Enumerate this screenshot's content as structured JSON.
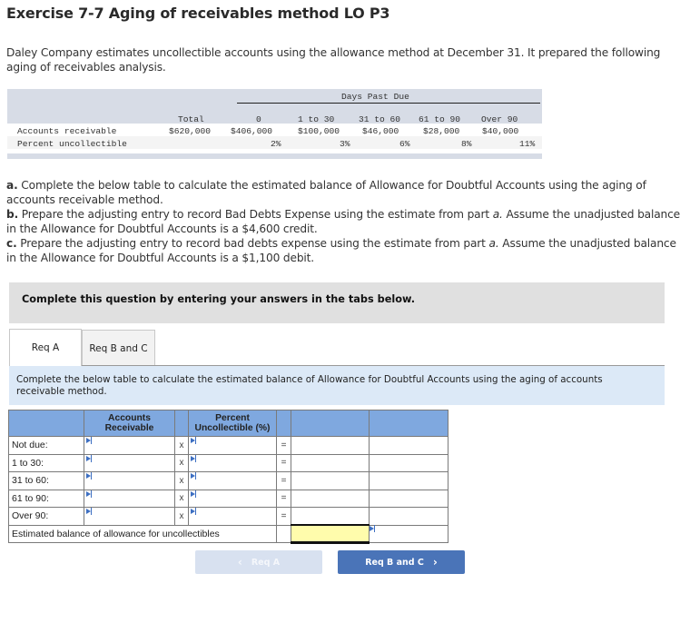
{
  "title": "Exercise 7-7 Aging of receivables method LO P3",
  "intro": "Daley Company estimates uncollectible accounts using the allowance method at December 31. It prepared the following aging of receivables analysis.",
  "aging_table": {
    "group_header": "Days Past Due",
    "columns": [
      "Total",
      "0",
      "1 to 30",
      "31 to 60",
      "61 to 90",
      "Over 90"
    ],
    "rows": [
      {
        "label": "Accounts receivable",
        "values": [
          "$620,000",
          "$406,000",
          "$100,000",
          "$46,000",
          "$28,000",
          "$40,000"
        ]
      },
      {
        "label": "Percent uncollectible",
        "values": [
          "",
          "2%",
          "3%",
          "6%",
          "8%",
          "11%"
        ]
      }
    ]
  },
  "instructions": [
    {
      "tag": "a.",
      "text": " Complete the below table to calculate the estimated balance of Allowance for Doubtful Accounts using the aging of accounts receivable method."
    },
    {
      "tag": "b.",
      "text_before": " Prepare the adjusting entry to record Bad Debts Expense using the estimate from part ",
      "italic": "a.",
      "text_after": " Assume the unadjusted balance in the Allowance for Doubtful Accounts is a $4,600 credit."
    },
    {
      "tag": "c.",
      "text_before": " Prepare the adjusting entry to record bad debts expense using the estimate from part ",
      "italic": "a.",
      "text_after": " Assume the unadjusted balance in the Allowance for Doubtful Accounts is a $1,100 debit."
    }
  ],
  "banner": "Complete this question by entering your answers in the tabs below.",
  "tabs": [
    {
      "label": "Req A",
      "active": true
    },
    {
      "label": "Req B and C",
      "active": false
    }
  ],
  "tab_instruction": "Complete the below table to calculate the estimated balance of Allowance for Doubtful Accounts using the aging of accounts receivable method.",
  "answer_grid": {
    "headers": {
      "ar": "Accounts Receivable",
      "pct": "Percent Uncollectible (%)"
    },
    "multiply_symbol": "x",
    "equals_symbol": "=",
    "rows": [
      {
        "label": "Not due:",
        "ar": "",
        "pct": "",
        "result": ""
      },
      {
        "label": "1 to 30:",
        "ar": "",
        "pct": "",
        "result": ""
      },
      {
        "label": "31 to 60:",
        "ar": "",
        "pct": "",
        "result": ""
      },
      {
        "label": "61 to 90:",
        "ar": "",
        "pct": "",
        "result": ""
      },
      {
        "label": "Over 90:",
        "ar": "",
        "pct": "",
        "result": ""
      }
    ],
    "total_label": "Estimated balance of allowance for uncollectibles",
    "total_value": ""
  },
  "nav": {
    "prev_label": "Req A",
    "next_label": "Req B and C",
    "prev_icon": "‹",
    "next_icon": "›"
  },
  "colors": {
    "grid_header": "#7fa8df",
    "total_cell": "#fffcac",
    "next_button": "#4a74b8",
    "prev_button": "#d8e1f0",
    "info_box": "#dce9f7"
  }
}
